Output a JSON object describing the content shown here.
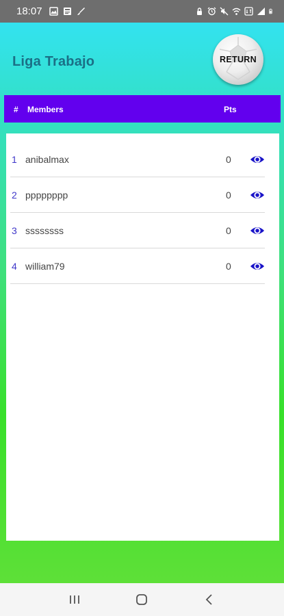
{
  "status_bar": {
    "time": "18:07",
    "left_icons": [
      "gallery-icon",
      "news-icon",
      "brush-icon"
    ],
    "right_icons": [
      "lock-icon",
      "alarm-icon",
      "mute-icon",
      "wifi-icon",
      "data-icon",
      "signal-icon",
      "battery-icon"
    ]
  },
  "header": {
    "title": "Liga Trabajo",
    "return_label": "RETURN"
  },
  "table": {
    "columns": {
      "rank": "#",
      "members": "Members",
      "points": "Pts"
    },
    "rows": [
      {
        "rank": "1",
        "name": "anibalmax",
        "points": "0"
      },
      {
        "rank": "2",
        "name": "pppppppp",
        "points": "0"
      },
      {
        "rank": "3",
        "name": "ssssssss",
        "points": "0"
      },
      {
        "rank": "4",
        "name": "william79",
        "points": "0"
      }
    ],
    "action_icon": "eye-icon"
  },
  "nav_bar": {
    "buttons": [
      "recent-apps-icon",
      "home-icon",
      "back-icon"
    ]
  },
  "colors": {
    "header_bar": "#6200ee",
    "title": "#1b6f86",
    "eye_icon": "#1a14c8",
    "rank_text": "#3f37c9",
    "gradient_top": "#33e2f0",
    "gradient_bottom": "#5ee038"
  }
}
